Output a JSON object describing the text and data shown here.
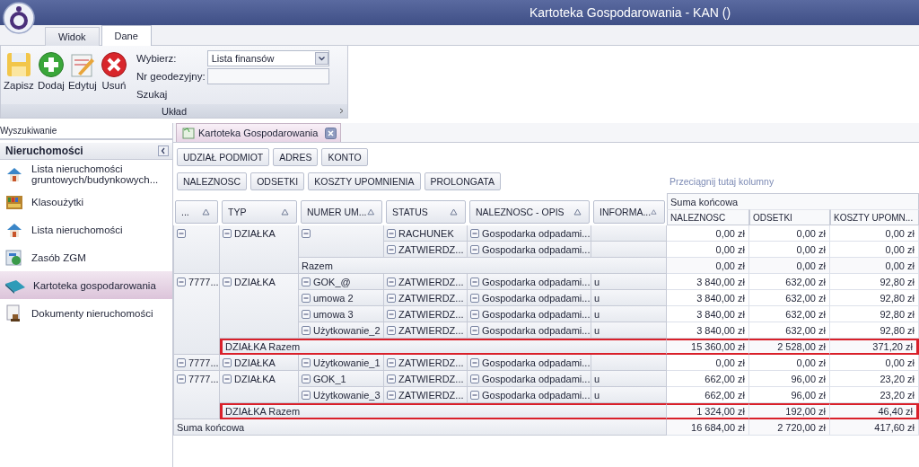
{
  "window": {
    "title": "Kartoteka Gospodarowania - KAN ()"
  },
  "ribbon_tabs": [
    {
      "label": "Widok",
      "selected": false
    },
    {
      "label": "Dane",
      "selected": true
    }
  ],
  "ribbon": {
    "buttons": [
      {
        "label": "Zapisz",
        "kind": "save"
      },
      {
        "label": "Dodaj",
        "kind": "add"
      },
      {
        "label": "Edytuj",
        "kind": "edit"
      },
      {
        "label": "Usuń",
        "kind": "delete"
      }
    ],
    "select": {
      "label": "Wybierz:",
      "value": "Lista finansów"
    },
    "geodetic": {
      "label": "Nr geodezyjny:"
    },
    "search_label": "Szukaj",
    "group_label": "Układ"
  },
  "search_panel": {
    "title": "Wyszukiwanie"
  },
  "sidebar": {
    "title": "Nieruchomości",
    "items": [
      {
        "label": "Lista nieruchomości gruntowych/budynkowych...",
        "kind": "house",
        "selected": false
      },
      {
        "label": "Klasoużytki",
        "kind": "shelf",
        "selected": false
      },
      {
        "label": "Lista nieruchomości",
        "kind": "house",
        "selected": false
      },
      {
        "label": "Zasób ZGM",
        "kind": "map",
        "selected": false
      },
      {
        "label": "Kartoteka gospodarowania",
        "kind": "book",
        "selected": true
      },
      {
        "label": "Dokumenty nieruchomości",
        "kind": "stamp",
        "selected": false
      }
    ]
  },
  "document_tab": {
    "label": "Kartoteka Gospodarowania"
  },
  "filter_fields": [
    "UDZIAŁ PODMIOT",
    "ADRES",
    "KONTO"
  ],
  "data_fields": [
    "NALEZNOSC",
    "ODSETKI",
    "KOSZTY UPOMNIENIA",
    "PROLONGATA"
  ],
  "column_drop_hint": "Przeciągnij tutaj kolumny",
  "grand_total_header": "Suma końcowa",
  "row_fields": [
    "...",
    "TYP",
    "NUMER UM...",
    "STATUS",
    "NALEZNOSC - OPIS",
    "INFORMA..."
  ],
  "value_columns": [
    "NALEZNOSC",
    "ODSETKI",
    "KOSZTY UPOMN..."
  ],
  "groups": [
    {
      "expanded": true,
      "type": {
        "label": "DZIAŁKA",
        "expanded": true
      },
      "numbers": [
        {
          "expanded": true,
          "lines": [
            {
              "status": "RACHUNEK",
              "opis": "Gospodarka odpadami...",
              "expanded": true,
              "values": [
                "0,00 zł",
                "0,00 zł",
                "0,00 zł"
              ]
            },
            {
              "status": "ZATWIERDZ...",
              "opis": "Gospodarka odpadami...",
              "expanded": true,
              "values": [
                "0,00 zł",
                "0,00 zł",
                "0,00 zł"
              ]
            }
          ]
        }
      ],
      "type_total": {
        "label": "Razem",
        "values": [
          "0,00 zł",
          "0,00 zł",
          "0,00 zł"
        ]
      }
    },
    {
      "key": "7777...",
      "expanded": true,
      "type": {
        "label": "DZIAŁKA",
        "expanded": true
      },
      "numbers": [
        {
          "label": "GOK_@",
          "expanded": true,
          "lines": [
            {
              "status": "ZATWIERDZ...",
              "opis": "Gospodarka odpadami...",
              "info": "u",
              "expanded": true,
              "values": [
                "3 840,00 zł",
                "632,00 zł",
                "92,80 zł"
              ]
            }
          ]
        },
        {
          "label": "umowa 2",
          "expanded": true,
          "lines": [
            {
              "status": "ZATWIERDZ...",
              "opis": "Gospodarka odpadami...",
              "info": "u",
              "expanded": true,
              "values": [
                "3 840,00 zł",
                "632,00 zł",
                "92,80 zł"
              ]
            }
          ]
        },
        {
          "label": "umowa 3",
          "expanded": true,
          "lines": [
            {
              "status": "ZATWIERDZ...",
              "opis": "Gospodarka odpadami...",
              "info": "u",
              "expanded": true,
              "values": [
                "3 840,00 zł",
                "632,00 zł",
                "92,80 zł"
              ]
            }
          ]
        },
        {
          "label": "Użytkowanie_2",
          "expanded": true,
          "lines": [
            {
              "status": "ZATWIERDZ...",
              "opis": "Gospodarka odpadami...",
              "info": "u",
              "expanded": true,
              "values": [
                "3 840,00 zł",
                "632,00 zł",
                "92,80 zł"
              ]
            }
          ]
        }
      ],
      "total": {
        "label": "DZIAŁKA Razem",
        "highlighted": true,
        "values": [
          "15 360,00 zł",
          "2 528,00 zł",
          "371,20 zł"
        ]
      }
    },
    {
      "key": "7777...",
      "expanded": true,
      "type": {
        "label": "DZIAŁKA",
        "expanded": true
      },
      "numbers": [
        {
          "label": "Użytkowanie_1",
          "expanded": true,
          "lines": [
            {
              "status": "ZATWIERDZ...",
              "opis": "Gospodarka odpadami...",
              "expanded": true,
              "values": [
                "0,00 zł",
                "0,00 zł",
                "0,00 zł"
              ]
            }
          ]
        }
      ]
    },
    {
      "key": "7777...",
      "expanded": true,
      "type": {
        "label": "DZIAŁKA",
        "expanded": true
      },
      "numbers": [
        {
          "label": "GOK_1",
          "expanded": true,
          "lines": [
            {
              "status": "ZATWIERDZ...",
              "opis": "Gospodarka odpadami...",
              "info": "u",
              "expanded": true,
              "values": [
                "662,00 zł",
                "96,00 zł",
                "23,20 zł"
              ]
            }
          ]
        },
        {
          "label": "Użytkowanie_3",
          "expanded": true,
          "lines": [
            {
              "status": "ZATWIERDZ...",
              "opis": "Gospodarka odpadami...",
              "info": "u",
              "expanded": true,
              "values": [
                "662,00 zł",
                "96,00 zł",
                "23,20 zł"
              ]
            }
          ]
        }
      ],
      "total": {
        "label": "DZIAŁKA Razem",
        "highlighted": true,
        "values": [
          "1 324,00 zł",
          "192,00 zł",
          "46,40 zł"
        ]
      }
    }
  ],
  "grand_total": {
    "label": "Suma końcowa",
    "values": [
      "16 684,00 zł",
      "2 720,00 zł",
      "417,60 zł"
    ]
  }
}
